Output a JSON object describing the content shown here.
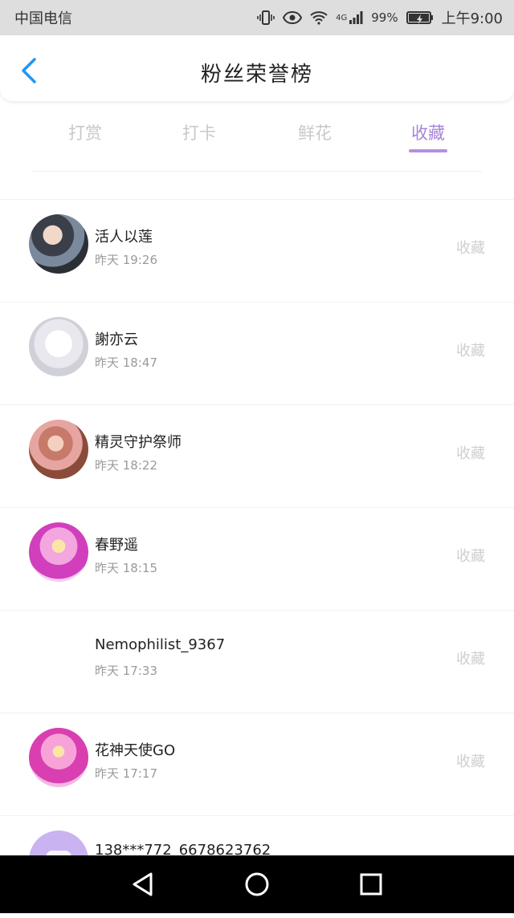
{
  "status_bar": {
    "carrier": "中国电信",
    "network": "4G",
    "battery": "99%",
    "time": "上午9:00"
  },
  "header": {
    "title": "粉丝荣誉榜",
    "back_icon": "chevron-left-icon"
  },
  "tabs": [
    {
      "label": "打赏",
      "active": false
    },
    {
      "label": "打卡",
      "active": false
    },
    {
      "label": "鲜花",
      "active": false
    },
    {
      "label": "收藏",
      "active": true
    }
  ],
  "list": [
    {
      "name": "活人以莲",
      "time": "昨天 19:26",
      "tag": "收藏"
    },
    {
      "name": "謝亦云",
      "time": "昨天 18:47",
      "tag": "收藏"
    },
    {
      "name": "精灵守护祭师",
      "time": "昨天 18:22",
      "tag": "收藏"
    },
    {
      "name": "春野遥",
      "time": "昨天 18:15",
      "tag": "收藏"
    },
    {
      "name": "Nemophilist_9367",
      "time": "昨天 17:33",
      "tag": "收藏"
    },
    {
      "name": "花神天使GO",
      "time": "昨天 17:17",
      "tag": "收藏"
    },
    {
      "name": "138***772_6678623762",
      "time": "",
      "tag": ""
    }
  ],
  "colors": {
    "accent": "#b58fe0",
    "status_bar_bg": "#dedede",
    "back_arrow": "#2196f3",
    "nav_bar_bg": "#000000"
  }
}
